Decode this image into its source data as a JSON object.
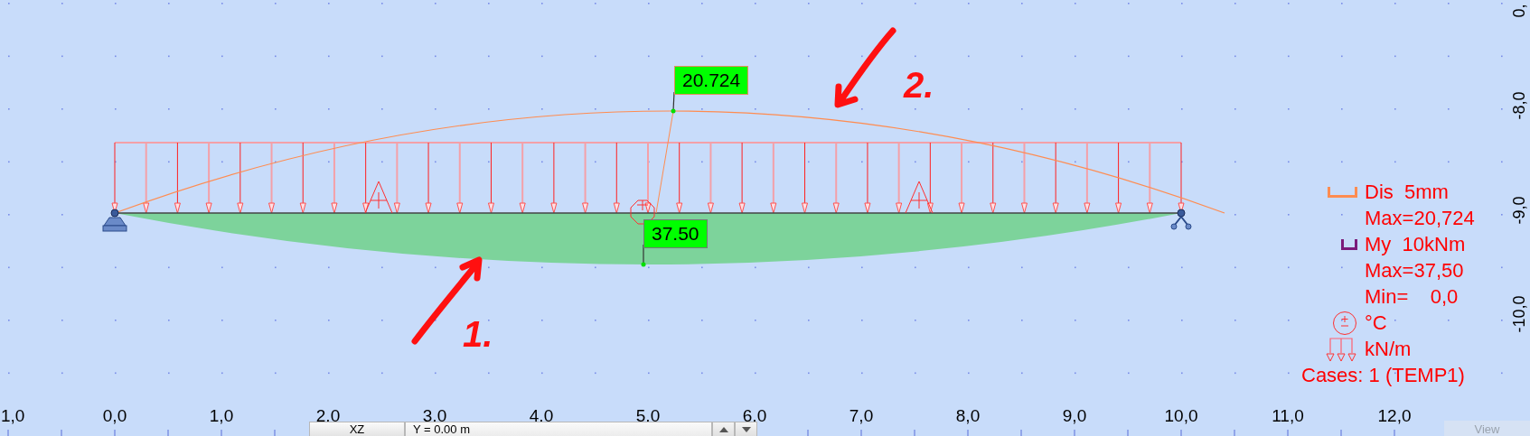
{
  "x_axis": {
    "labels": [
      "1,0",
      "0,0",
      "1,0",
      "2,0",
      "3,0",
      "4,0",
      "5,0",
      "6,0",
      "7,0",
      "8,0",
      "9,0",
      "10,0",
      "11,0",
      "12,0"
    ]
  },
  "y_axis": {
    "labels": [
      "0,",
      "-8,0",
      "-9,0",
      "-10,0"
    ]
  },
  "tags": [
    {
      "kind": "displacement",
      "value": "20.724"
    },
    {
      "kind": "moment",
      "value": "37.50"
    }
  ],
  "annotations": [
    {
      "label": "1."
    },
    {
      "label": "2."
    }
  ],
  "legend": {
    "items": [
      {
        "kind": "displacement",
        "lines": [
          "Dis  5mm",
          "Max=20,724"
        ]
      },
      {
        "kind": "moment",
        "lines": [
          "My  10kNm",
          "Max=37,50",
          "Min=    0,0"
        ]
      },
      {
        "kind": "temperature",
        "lines": [
          "°C"
        ]
      },
      {
        "kind": "line-load",
        "lines": [
          "kN/m"
        ]
      }
    ],
    "cases": "Cases: 1 (TEMP1)"
  },
  "status_bar": {
    "plane": "XZ",
    "position": "Y = 0.00 m"
  },
  "view_tab": "View"
}
